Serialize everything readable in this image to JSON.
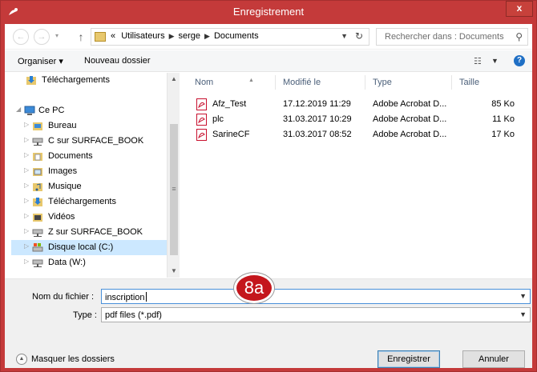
{
  "window": {
    "title": "Enregistrement",
    "close_label": "x"
  },
  "nav": {
    "back_glyph": "←",
    "forward_glyph": "→",
    "up_glyph": "↑",
    "address_prefix": "«",
    "breadcrumbs": [
      "Utilisateurs",
      "serge",
      "Documents"
    ],
    "search_placeholder": "Rechercher dans : Documents"
  },
  "toolbar": {
    "organize_label": "Organiser ▾",
    "new_folder_label": "Nouveau dossier"
  },
  "sidebar": {
    "items": [
      {
        "label": "Téléchargements",
        "icon": "downloads-icon"
      },
      {
        "label": "Ce PC",
        "icon": "computer-icon"
      },
      {
        "label": "Bureau",
        "icon": "desktop-folder-icon"
      },
      {
        "label": "C sur SURFACE_BOOK",
        "icon": "network-drive-icon"
      },
      {
        "label": "Documents",
        "icon": "documents-folder-icon"
      },
      {
        "label": "Images",
        "icon": "pictures-folder-icon"
      },
      {
        "label": "Musique",
        "icon": "music-folder-icon"
      },
      {
        "label": "Téléchargements",
        "icon": "downloads-icon"
      },
      {
        "label": "Vidéos",
        "icon": "videos-folder-icon"
      },
      {
        "label": "Z sur SURFACE_BOOK",
        "icon": "network-drive-icon"
      },
      {
        "label": "Disque local (C:)",
        "icon": "local-disk-icon",
        "selected": true
      },
      {
        "label": "Data (W:)",
        "icon": "network-drive-icon"
      }
    ]
  },
  "filelist": {
    "columns": [
      "Nom",
      "Modifié le",
      "Type",
      "Taille"
    ],
    "rows": [
      {
        "name": "Afz_Test",
        "modified": "17.12.2019 11:29",
        "type": "Adobe Acrobat D...",
        "size": "85 Ko"
      },
      {
        "name": "plc",
        "modified": "31.03.2017 10:29",
        "type": "Adobe Acrobat D...",
        "size": "11 Ko"
      },
      {
        "name": "SarineCF",
        "modified": "31.03.2017 08:52",
        "type": "Adobe Acrobat D...",
        "size": "17 Ko"
      }
    ]
  },
  "form": {
    "filename_label": "Nom du fichier :",
    "filename_value": "inscription",
    "type_label": "Type :",
    "type_value": "pdf files (*.pdf)",
    "annotation_badge": "8a",
    "hide_folders_label": "Masquer les dossiers",
    "save_label": "Enregistrer",
    "cancel_label": "Annuler"
  },
  "colors": {
    "titlebar": "#c43a3a",
    "selection": "#cce8ff",
    "badge": "#c4161c",
    "pdf_red": "#c8102e"
  }
}
